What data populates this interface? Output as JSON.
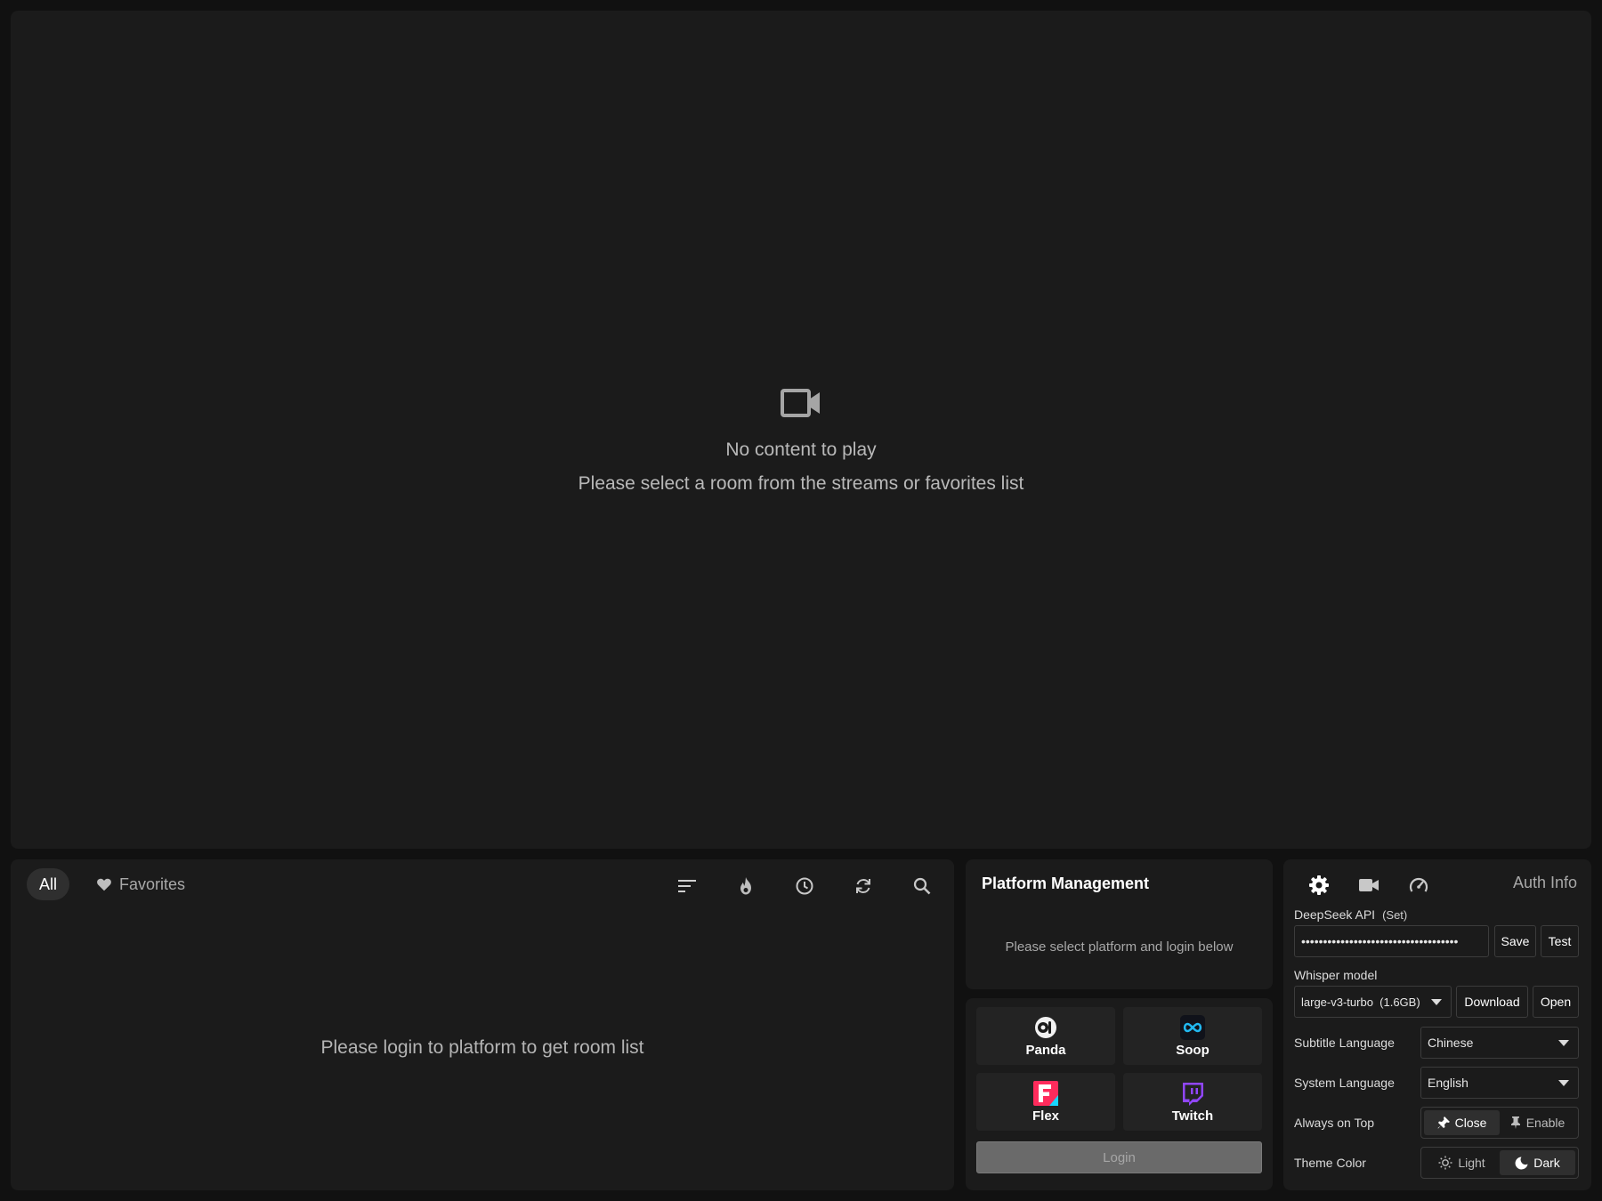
{
  "player": {
    "empty_icon": "video-camera-icon",
    "empty_title": "No content to play",
    "empty_subtitle": "Please select a room from the streams or favorites list"
  },
  "rooms": {
    "tabs": [
      {
        "label": "All",
        "active": true
      },
      {
        "label": "Favorites",
        "icon": "heart-icon",
        "active": false
      }
    ],
    "toolbar_icons": [
      "sort-icon",
      "hot-flame-icon",
      "clock-icon",
      "refresh-icon",
      "search-icon"
    ],
    "empty_message": "Please login to platform to get room list"
  },
  "platform_management": {
    "title": "Platform Management",
    "hint": "Please select platform and login below",
    "platforms": [
      {
        "name": "Panda",
        "icon": "panda-logo-icon"
      },
      {
        "name": "Soop",
        "icon": "soop-logo-icon",
        "color": "#22b8f0"
      },
      {
        "name": "Flex",
        "icon": "flex-logo-icon",
        "color": "#ff2b5c"
      },
      {
        "name": "Twitch",
        "icon": "twitch-logo-icon",
        "color": "#9146ff"
      }
    ],
    "login_label": "Login"
  },
  "settings": {
    "tab_icons": [
      "gear-icon",
      "video-camera-icon",
      "speedometer-icon"
    ],
    "auth_info": "Auth Info",
    "deepseek": {
      "label": "DeepSeek API",
      "status": "(Set)",
      "value": "••••••••••••••••••••••••••••••••••••",
      "save_label": "Save",
      "test_label": "Test"
    },
    "whisper": {
      "label": "Whisper model",
      "value": "large-v3-turbo  (1.6GB)",
      "download_label": "Download",
      "open_label": "Open"
    },
    "subtitle_language": {
      "label": "Subtitle Language",
      "value": "Chinese"
    },
    "system_language": {
      "label": "System Language",
      "value": "English"
    },
    "always_on_top": {
      "label": "Always on Top",
      "options": [
        {
          "label": "Close",
          "icon": "pin-icon",
          "active": true
        },
        {
          "label": "Enable",
          "icon": "pin-outline-icon",
          "active": false
        }
      ]
    },
    "theme": {
      "label": "Theme Color",
      "options": [
        {
          "label": "Light",
          "icon": "sun-icon",
          "active": false
        },
        {
          "label": "Dark",
          "icon": "moon-icon",
          "active": true
        }
      ]
    }
  }
}
